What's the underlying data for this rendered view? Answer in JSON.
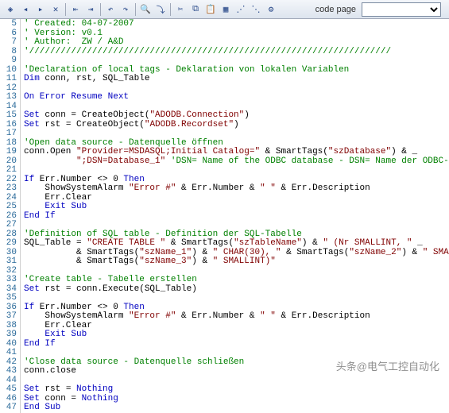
{
  "toolbar": {
    "codepage_label": "code page",
    "codepage_value": "",
    "icons": [
      "bookmark-toggle",
      "bookmark-prev",
      "bookmark-next",
      "bookmark-clear",
      "indent-left",
      "indent-right",
      "undo",
      "redo",
      "find",
      "replace",
      "run",
      "step",
      "stop",
      "select-all",
      "comment",
      "uncomment",
      "tools",
      "help"
    ]
  },
  "watermark": "头条@电气工控自动化",
  "gutter": {
    "start": 5,
    "end": 47
  },
  "lines": [
    [
      {
        "c": "cmt",
        "t": "' Created: 04-07-2007"
      }
    ],
    [
      {
        "c": "cmt",
        "t": "' Version: v0.1"
      }
    ],
    [
      {
        "c": "cmt",
        "t": "' Author:  ZW / A&D"
      }
    ],
    [
      {
        "c": "cmt",
        "t": "'/////////////////////////////////////////////////////////////////////"
      }
    ],
    [],
    [
      {
        "c": "cmt",
        "t": "'Declaration of local tags - Deklaration von lokalen Variablen"
      }
    ],
    [
      {
        "c": "kw",
        "t": "Dim"
      },
      {
        "c": "blk",
        "t": " conn, rst, SQL_Table"
      }
    ],
    [],
    [
      {
        "c": "kw",
        "t": "On Error Resume Next"
      }
    ],
    [],
    [
      {
        "c": "kw",
        "t": "Set"
      },
      {
        "c": "blk",
        "t": " conn = CreateObject("
      },
      {
        "c": "str",
        "t": "\"ADODB.Connection\""
      },
      {
        "c": "blk",
        "t": ")"
      }
    ],
    [
      {
        "c": "kw",
        "t": "Set"
      },
      {
        "c": "blk",
        "t": " rst = CreateObject("
      },
      {
        "c": "str",
        "t": "\"ADODB.Recordset\""
      },
      {
        "c": "blk",
        "t": ")"
      }
    ],
    [],
    [
      {
        "c": "cmt",
        "t": "'Open data source - Datenquelle öffnen"
      }
    ],
    [
      {
        "c": "blk",
        "t": "conn.Open "
      },
      {
        "c": "str",
        "t": "\"Provider=MSDASQL;Initial Catalog=\""
      },
      {
        "c": "blk",
        "t": " & SmartTags("
      },
      {
        "c": "str",
        "t": "\"szDatabase\""
      },
      {
        "c": "blk",
        "t": ") & _"
      }
    ],
    [
      {
        "c": "blk",
        "t": "          "
      },
      {
        "c": "str",
        "t": "\";DSN=Database_1\""
      },
      {
        "c": "blk",
        "t": " "
      },
      {
        "c": "cmt",
        "t": "'DSN= Name of the ODBC database - DSN= Name der ODBC-Datenbank"
      }
    ],
    [],
    [
      {
        "c": "kw",
        "t": "If"
      },
      {
        "c": "blk",
        "t": " Err.Number <> 0 "
      },
      {
        "c": "kw",
        "t": "Then"
      }
    ],
    [
      {
        "c": "blk",
        "t": "    ShowSystemAlarm "
      },
      {
        "c": "str",
        "t": "\"Error #\""
      },
      {
        "c": "blk",
        "t": " & Err.Number & "
      },
      {
        "c": "str",
        "t": "\" \""
      },
      {
        "c": "blk",
        "t": " & Err.Description"
      }
    ],
    [
      {
        "c": "blk",
        "t": "    Err.Clear"
      }
    ],
    [
      {
        "c": "blk",
        "t": "    "
      },
      {
        "c": "kw",
        "t": "Exit Sub"
      }
    ],
    [
      {
        "c": "kw",
        "t": "End If"
      }
    ],
    [],
    [
      {
        "c": "cmt",
        "t": "'Definition of SQL table - Definition der SQL-Tabelle"
      }
    ],
    [
      {
        "c": "blk",
        "t": "SQL_Table = "
      },
      {
        "c": "str",
        "t": "\"CREATE TABLE \""
      },
      {
        "c": "blk",
        "t": " & SmartTags("
      },
      {
        "c": "str",
        "t": "\"szTableName\""
      },
      {
        "c": "blk",
        "t": ") & "
      },
      {
        "c": "str",
        "t": "\" (Nr SMALLINT, \""
      },
      {
        "c": "blk",
        "t": " _"
      }
    ],
    [
      {
        "c": "blk",
        "t": "          & SmartTags("
      },
      {
        "c": "str",
        "t": "\"szName_1\""
      },
      {
        "c": "blk",
        "t": ") & "
      },
      {
        "c": "str",
        "t": "\" CHAR(30), \""
      },
      {
        "c": "blk",
        "t": " & SmartTags("
      },
      {
        "c": "str",
        "t": "\"szName_2\""
      },
      {
        "c": "blk",
        "t": ") & "
      },
      {
        "c": "str",
        "t": "\" SMALLINT, \""
      },
      {
        "c": "blk",
        "t": " _"
      }
    ],
    [
      {
        "c": "blk",
        "t": "          & SmartTags("
      },
      {
        "c": "str",
        "t": "\"szName_3\""
      },
      {
        "c": "blk",
        "t": ") & "
      },
      {
        "c": "str",
        "t": "\" SMALLINT)\""
      }
    ],
    [],
    [
      {
        "c": "cmt",
        "t": "'Create table - Tabelle erstellen"
      }
    ],
    [
      {
        "c": "kw",
        "t": "Set"
      },
      {
        "c": "blk",
        "t": " rst = conn.Execute(SQL_Table)"
      }
    ],
    [],
    [
      {
        "c": "kw",
        "t": "If"
      },
      {
        "c": "blk",
        "t": " Err.Number <> 0 "
      },
      {
        "c": "kw",
        "t": "Then"
      }
    ],
    [
      {
        "c": "blk",
        "t": "    ShowSystemAlarm "
      },
      {
        "c": "str",
        "t": "\"Error #\""
      },
      {
        "c": "blk",
        "t": " & Err.Number & "
      },
      {
        "c": "str",
        "t": "\" \""
      },
      {
        "c": "blk",
        "t": " & Err.Description"
      }
    ],
    [
      {
        "c": "blk",
        "t": "    Err.Clear"
      }
    ],
    [
      {
        "c": "blk",
        "t": "    "
      },
      {
        "c": "kw",
        "t": "Exit Sub"
      }
    ],
    [
      {
        "c": "kw",
        "t": "End If"
      }
    ],
    [],
    [
      {
        "c": "cmt",
        "t": "'Close data source - Datenquelle schließen"
      }
    ],
    [
      {
        "c": "blk",
        "t": "conn.close"
      }
    ],
    [],
    [
      {
        "c": "kw",
        "t": "Set"
      },
      {
        "c": "blk",
        "t": " rst = "
      },
      {
        "c": "kw",
        "t": "Nothing"
      }
    ],
    [
      {
        "c": "kw",
        "t": "Set"
      },
      {
        "c": "blk",
        "t": " conn = "
      },
      {
        "c": "kw",
        "t": "Nothing"
      }
    ],
    [
      {
        "c": "kw",
        "t": "End Sub"
      }
    ]
  ]
}
